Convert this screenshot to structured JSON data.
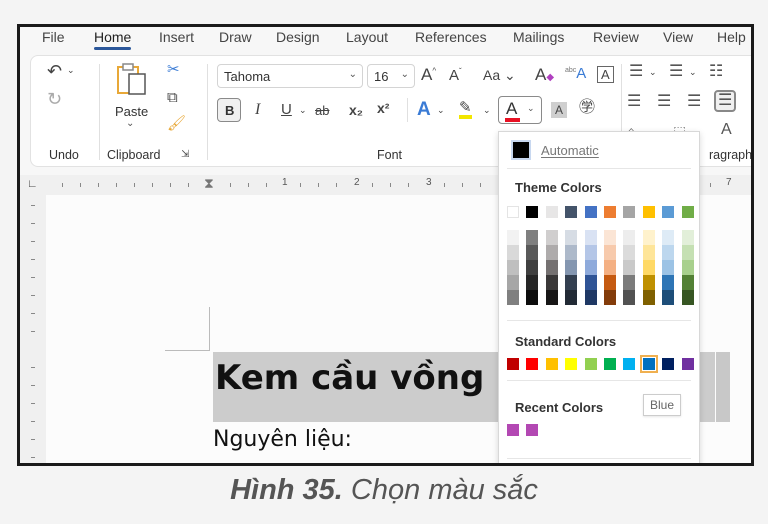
{
  "tabs": [
    "File",
    "Home",
    "Insert",
    "Draw",
    "Design",
    "Layout",
    "References",
    "Mailings",
    "Review",
    "View",
    "Help"
  ],
  "active_tab": "Home",
  "ribbon": {
    "groups": {
      "undo": "Undo",
      "clipboard": "Clipboard",
      "font": "Font",
      "paragraph": "ragraph"
    },
    "paste_label": "Paste",
    "font_name": "Tahoma",
    "font_size": "16",
    "case_label": "Aa",
    "bold": "B",
    "italic": "I",
    "underline": "U",
    "strike": "ab",
    "subscript": "x₂",
    "superscript": "x²",
    "font_color_letter": "A",
    "font_color": "#e81123",
    "highlight_color": "#f2e600"
  },
  "ruler": {
    "numbers": [
      "1",
      "2",
      "3",
      "7"
    ]
  },
  "document": {
    "heading": "Kem cầu vồng",
    "body": "Nguyên liệu:"
  },
  "color_menu": {
    "automatic_label": "Automatic",
    "automatic_color": "#000000",
    "theme_header": "Theme Colors",
    "theme_base": [
      "#ffffff",
      "#000000",
      "#e7e6e6",
      "#44546a",
      "#4472c4",
      "#ed7d31",
      "#a5a5a5",
      "#ffc000",
      "#5b9bd5",
      "#70ad47"
    ],
    "theme_shades": [
      [
        "#f2f2f2",
        "#d9d9d9",
        "#bfbfbf",
        "#a6a6a6",
        "#808080"
      ],
      [
        "#7f7f7f",
        "#595959",
        "#404040",
        "#262626",
        "#0d0d0d"
      ],
      [
        "#d0cece",
        "#aeabab",
        "#757171",
        "#3a3838",
        "#171616"
      ],
      [
        "#d6dce4",
        "#adb9ca",
        "#8496b0",
        "#333f50",
        "#222a35"
      ],
      [
        "#d9e2f3",
        "#b4c6e7",
        "#8eaadb",
        "#2f5496",
        "#1f3864"
      ],
      [
        "#fbe5d5",
        "#f7caac",
        "#f4b083",
        "#c55a11",
        "#833c0b"
      ],
      [
        "#ededed",
        "#dbdbdb",
        "#c9c9c9",
        "#7b7b7b",
        "#525252"
      ],
      [
        "#fff2cc",
        "#fee599",
        "#ffd965",
        "#bf9000",
        "#7f6000"
      ],
      [
        "#deebf6",
        "#bdd7ee",
        "#9cc3e5",
        "#2e75b5",
        "#1e4e79"
      ],
      [
        "#e2efd9",
        "#c5e0b3",
        "#a8d08d",
        "#538135",
        "#375623"
      ]
    ],
    "standard_header": "Standard Colors",
    "standard": [
      "#c00000",
      "#ff0000",
      "#ffc000",
      "#ffff00",
      "#92d050",
      "#00b050",
      "#00b0f0",
      "#0070c0",
      "#002060",
      "#7030a0"
    ],
    "selected_standard_index": 7,
    "tooltip": "Blue",
    "recent_header": "Recent Colors",
    "recent": [
      "#b348b3",
      "#b348b3"
    ]
  },
  "caption": {
    "bold": "Hình 35.",
    "text": " Chọn màu sắc"
  }
}
